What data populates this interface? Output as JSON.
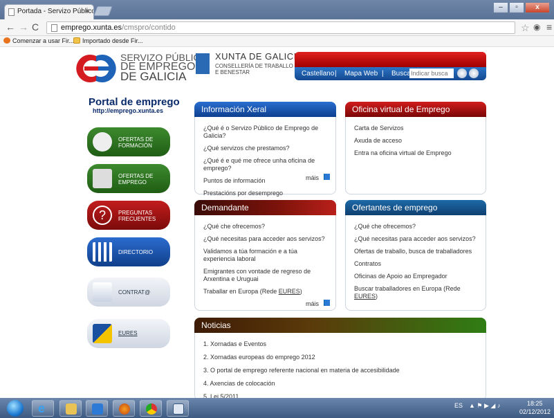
{
  "browser": {
    "tab_title": "Portada - Servizo Público",
    "tab_close": "×",
    "url_host": "emprego.xunta.es",
    "url_path": "/cmspro/contido",
    "bookmarks": [
      "Comenzar a usar Fir...",
      "Importado desde Fir..."
    ],
    "window_buttons": [
      "–",
      "▫",
      "x"
    ]
  },
  "header": {
    "logo_lines": [
      "SERVIZO PÚBLICO",
      "DE EMPREGO",
      "DE GALICIA"
    ],
    "xunta_title": "XUNTA DE GALICIA",
    "xunta_sub": [
      "CONSELLERÍA DE TRABALLO",
      "E BENESTAR"
    ],
    "nav": [
      "Castellano",
      "|",
      "Mapa Web",
      "|",
      "Buscar"
    ],
    "search_placeholder": "Indicar busca"
  },
  "sidebar": {
    "portal_title": "Portal de emprego",
    "portal_url": "http://emprego.xunta.es",
    "buttons": [
      {
        "label1": "OFERTAS DE",
        "label2": "FORMACIÓN"
      },
      {
        "label1": "OFERTAS DE",
        "label2": "EMPREGO"
      },
      {
        "label1": "PREGUNTAS",
        "label2": "FRECUENTES"
      },
      {
        "label1": "DIRECTORIO",
        "label2": ""
      },
      {
        "label1": "CONTRAT@",
        "label2": ""
      },
      {
        "label1": "EURES",
        "label2": ""
      }
    ]
  },
  "boxes": {
    "info": {
      "title": "Información Xeral",
      "items": [
        "¿Qué é o Servizo Público de Emprego de Galicia?",
        "¿Qué servizos che prestamos?",
        "¿Qué é e qué me ofrece unha oficina de emprego?",
        "Puntos de información",
        "Prestacións por desemprego"
      ],
      "more": "máis"
    },
    "oficina": {
      "title": "Oficina virtual de Emprego",
      "items": [
        "Carta de Servizos",
        "Axuda de acceso",
        "Entra na oficina virtual de Emprego"
      ]
    },
    "demandante": {
      "title": "Demandante",
      "items": [
        "¿Qué che ofrecemos?",
        "¿Qué necesitas para acceder aos servizos?",
        "Validamos a túa formación e a túa experiencia laboral",
        "Emigrantes con vontade de regreso de Arxentina e Uruguai",
        "Traballar en Europa (Rede ",
        "EURES",
        ")"
      ],
      "more": "máis"
    },
    "ofertantes": {
      "title": "Ofertantes de emprego",
      "items": [
        "¿Qué che ofrecemos?",
        "¿Qué necesitas para acceder aos servizos?",
        "Ofertas de traballo, busca de traballadores",
        "Contratos",
        "Oficinas de Apoio ao Empregador",
        "Buscar traballadores en Europa (Rede ",
        "EURES",
        ")"
      ]
    },
    "noticias": {
      "title": "Noticias",
      "items": [
        "1.  Xornadas e Eventos",
        "2.  Xornadas europeas do emprego 2012",
        "3.  O portal de emprego referente nacional en materia de accesibilidade",
        "4.  Axencias de colocación",
        "5.  Lei 5/2011"
      ]
    }
  },
  "taskbar": {
    "lang": "ES",
    "time": "18:25",
    "date": "02/12/2012"
  }
}
